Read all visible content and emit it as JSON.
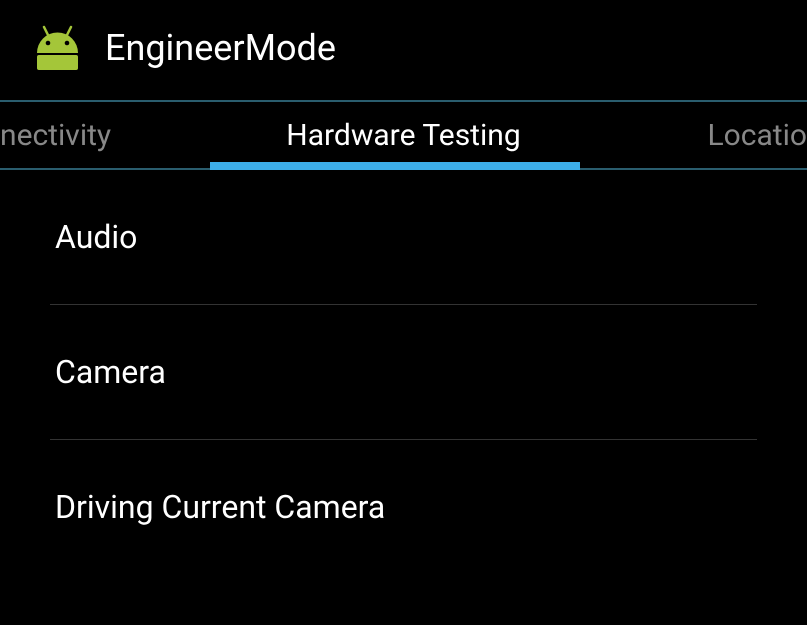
{
  "header": {
    "title": "EngineerMode"
  },
  "tabs": {
    "left": "nectivity",
    "center": "Hardware Testing",
    "right": "Locatio",
    "active_index": 1
  },
  "list": {
    "items": [
      {
        "label": "Audio"
      },
      {
        "label": "Camera"
      },
      {
        "label": "Driving Current Camera"
      }
    ]
  }
}
